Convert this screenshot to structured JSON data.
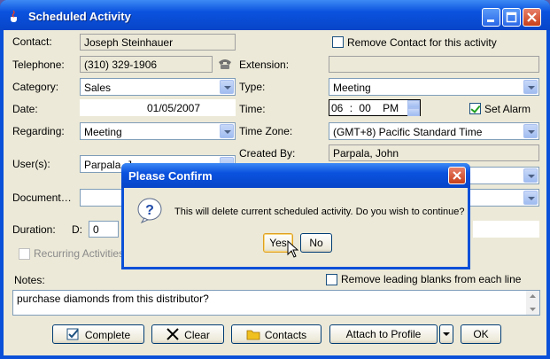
{
  "window": {
    "title": "Scheduled Activity"
  },
  "form": {
    "contact_label": "Contact:",
    "contact_value": "Joseph Steinhauer",
    "remove_contact_label": "Remove Contact for this activity",
    "telephone_label": "Telephone:",
    "telephone_value": "(310) 329-1906",
    "extension_label": "Extension:",
    "extension_value": "",
    "category_label": "Category:",
    "category_value": "Sales",
    "type_label": "Type:",
    "type_value": "Meeting",
    "date_label": "Date:",
    "date_value": "01/05/2007",
    "time_label": "Time:",
    "time_hour": "06",
    "time_sep": ":",
    "time_minute": "00",
    "time_ampm": "PM",
    "set_alarm_label": "Set Alarm",
    "regarding_label": "Regarding:",
    "regarding_value": "Meeting",
    "timezone_label": "Time Zone:",
    "timezone_value": "(GMT+8) Pacific Standard Time",
    "created_by_label": "Created By:",
    "created_by_value": "Parpala, John",
    "users_label": "User(s):",
    "users_value": "Parpala, J",
    "document_label": "Document…",
    "duration_label": "Duration:",
    "duration_d_label": "D:",
    "duration_d_value": "0",
    "recurring_label": "Recurring Activities",
    "notes_label": "Notes:",
    "remove_blanks_label": "Remove leading blanks from each line",
    "notes_value": "purchase diamonds from this distributor?"
  },
  "buttons": {
    "complete": "Complete",
    "clear": "Clear",
    "contacts": "Contacts",
    "attach": "Attach to Profile",
    "ok": "OK"
  },
  "dialog": {
    "title": "Please Confirm",
    "message": "This will delete current scheduled activity. Do you wish to continue?",
    "yes": "Yes",
    "no": "No"
  },
  "colors": {
    "titlebar": "#0a52de",
    "window_bg": "#ece9d8",
    "close": "#c8401a"
  },
  "icons": [
    "java-cup-icon",
    "minimize-icon",
    "maximize-icon",
    "close-icon",
    "phone-icon",
    "question-icon",
    "checkmark-icon",
    "x-icon",
    "folder-icon",
    "mouse-cursor-icon"
  ]
}
